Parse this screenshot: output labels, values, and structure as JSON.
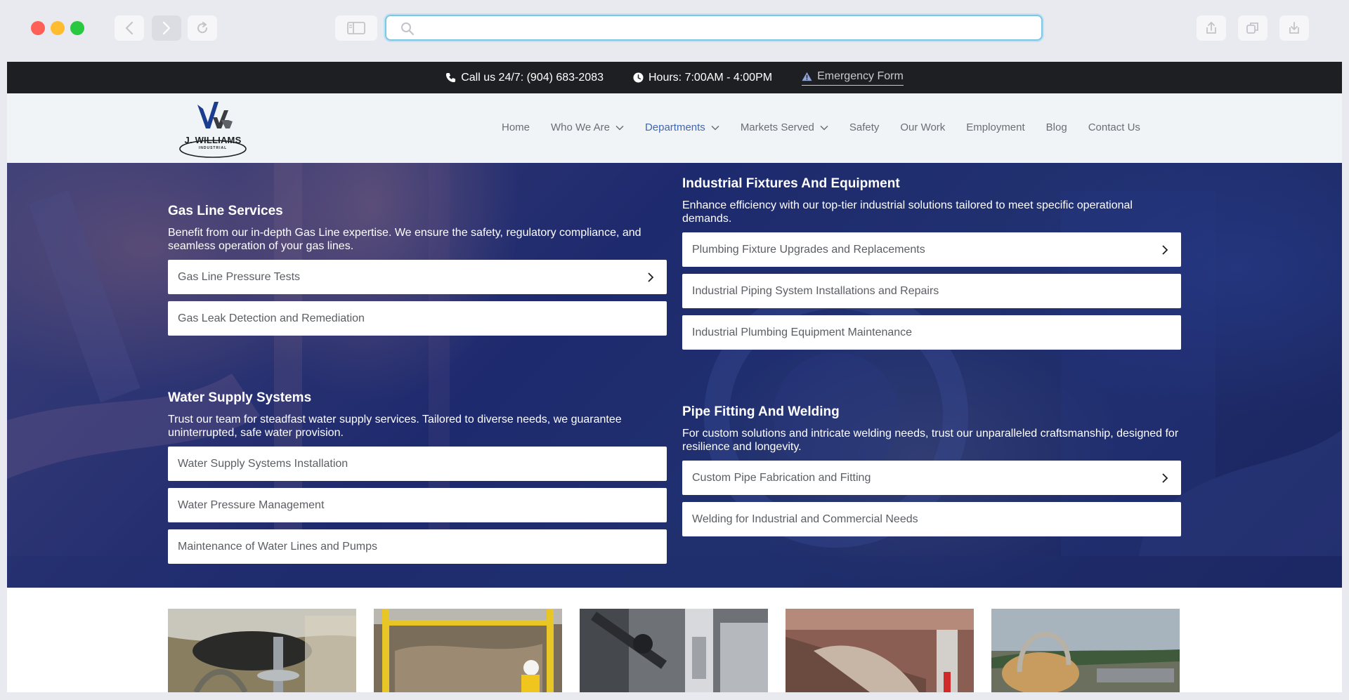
{
  "topbar": {
    "phone": "Call us 24/7: (904) 683-2083",
    "hours": "Hours: 7:00AM - 4:00PM",
    "emergency": "Emergency Form"
  },
  "logo": {
    "name": "J. WILLIAMS",
    "sub": "INDUSTRIAL"
  },
  "nav": {
    "items": [
      {
        "label": "Home"
      },
      {
        "label": "Who We Are"
      },
      {
        "label": "Departments"
      },
      {
        "label": "Markets Served"
      },
      {
        "label": "Safety"
      },
      {
        "label": "Our Work"
      },
      {
        "label": "Employment"
      },
      {
        "label": "Blog"
      },
      {
        "label": "Contact Us"
      }
    ],
    "active_color": "#3f67b3"
  },
  "sections": {
    "gas": {
      "title": "Gas Line Services",
      "desc": "Benefit from our in-depth Gas Line expertise. We ensure the safety, regulatory compliance, and seamless operation of your gas lines.",
      "links": [
        "Gas Line Pressure Tests",
        "Gas Leak Detection and Remediation"
      ]
    },
    "industrial": {
      "title": "Industrial Fixtures And Equipment",
      "desc": "Enhance efficiency with our top-tier industrial solutions tailored to meet specific operational demands.",
      "links": [
        "Plumbing Fixture Upgrades and Replacements",
        "Industrial Piping System Installations and Repairs",
        "Industrial Plumbing Equipment Maintenance"
      ]
    },
    "water": {
      "title": "Water Supply Systems",
      "desc": "Trust our team for steadfast water supply services. Tailored to diverse needs, we guarantee uninterrupted, safe water provision.",
      "links": [
        "Water Supply Systems Installation",
        "Water Pressure Management",
        "Maintenance of Water Lines and Pumps"
      ]
    },
    "pipe": {
      "title": "Pipe Fitting And Welding",
      "desc": "For custom solutions and intricate welding needs, trust our unparalleled craftsmanship, designed for resilience and longevity.",
      "links": [
        "Custom Pipe Fabrication and Fitting",
        "Welding for Industrial and Commercial Needs"
      ]
    }
  }
}
